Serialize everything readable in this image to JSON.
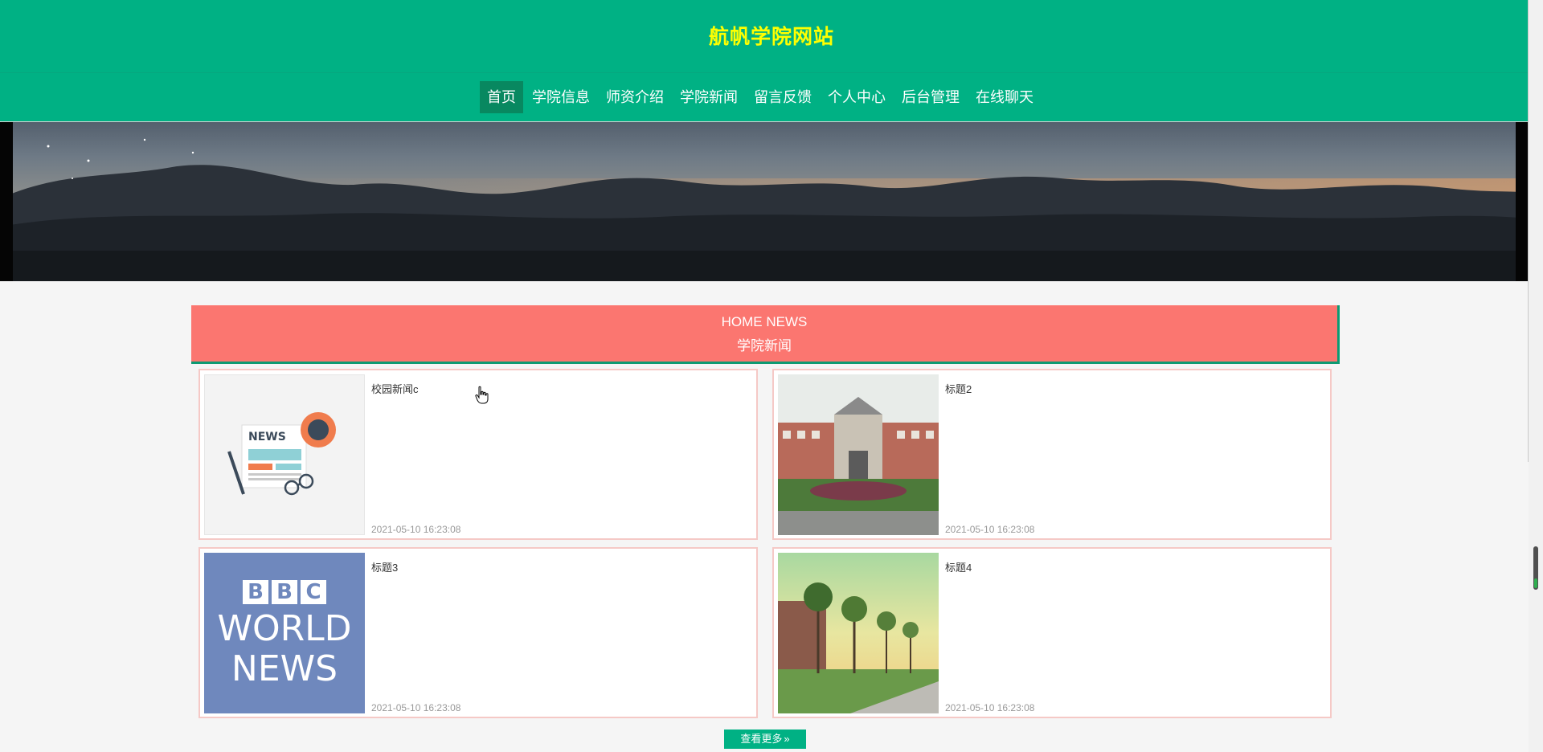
{
  "header": {
    "title": "航帆学院网站"
  },
  "nav": {
    "items": [
      {
        "label": "首页",
        "active": true
      },
      {
        "label": "学院信息"
      },
      {
        "label": "师资介绍"
      },
      {
        "label": "学院新闻"
      },
      {
        "label": "留言反馈"
      },
      {
        "label": "个人中心"
      },
      {
        "label": "后台管理"
      },
      {
        "label": "在线聊天"
      }
    ]
  },
  "section": {
    "title_en": "HOME NEWS",
    "title_cn": "学院新闻"
  },
  "news": [
    {
      "title": "校园新闻c",
      "time": "2021-05-10 16:23:08",
      "thumb": "news-illustration"
    },
    {
      "title": "标题2",
      "time": "2021-05-10 16:23:08",
      "thumb": "campus-building-photo"
    },
    {
      "title": "标题3",
      "time": "2021-05-10 16:23:08",
      "thumb": "bbc-world-news-logo",
      "thumb_text": [
        "BBC",
        "WORLD",
        "NEWS"
      ]
    },
    {
      "title": "标题4",
      "time": "2021-05-10 16:23:08",
      "thumb": "campus-trees-photo"
    }
  ],
  "more_button": {
    "label": "查看更多",
    "icon": "double-chevron-right-icon"
  },
  "colors": {
    "primary": "#00b184",
    "title_yellow": "#ffff00",
    "section_red": "#fb7670",
    "card_border": "#f5c9c6"
  }
}
